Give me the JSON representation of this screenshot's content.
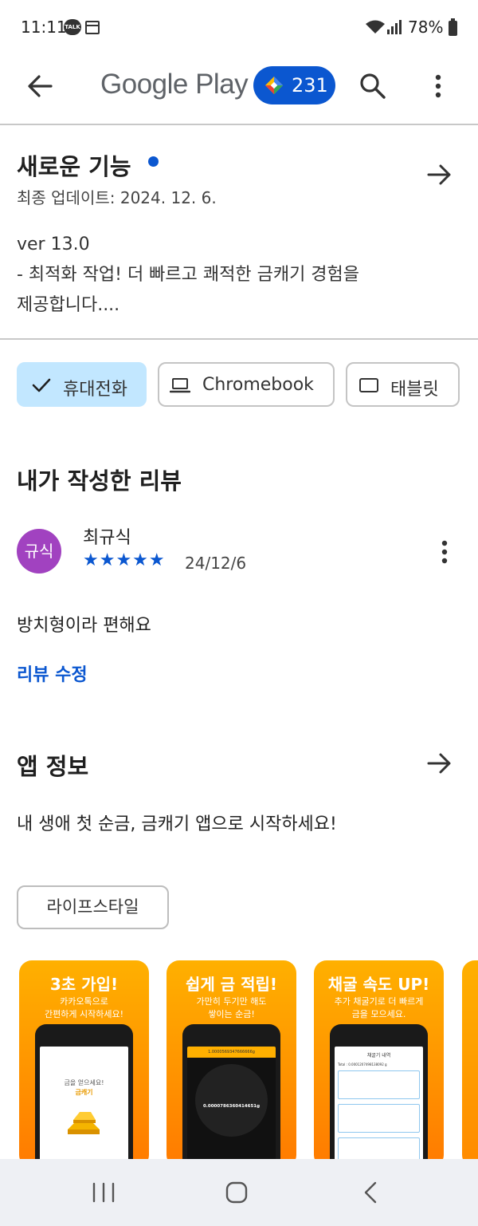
{
  "status_bar": {
    "time": "11:11",
    "talk_badge": "TALK",
    "battery": "78%"
  },
  "app_bar": {
    "brand": "Google Play",
    "points": "231"
  },
  "whats_new": {
    "title": "새로운 기능",
    "updated": "최종 업데이트: 2024. 12. 6.",
    "version": "ver 13.0",
    "body_line1": "- 최적화 작업! 더 빠르고 쾌적한 금캐기 경험을",
    "body_line2": "제공합니다...."
  },
  "devices": {
    "phone": "휴대전화",
    "chromebook": "Chromebook",
    "tablet": "태블릿"
  },
  "my_review": {
    "heading": "내가 작성한 리뷰",
    "avatar_initials": "규식",
    "author": "최규식",
    "stars": "★★★★★",
    "rating": 5,
    "date": "24/12/6",
    "text": "방치형이라 편해요",
    "edit_label": "리뷰 수정"
  },
  "app_info": {
    "heading": "앱 정보",
    "description": "내 생애 첫 순금, 금캐기 앱으로 시작하세요!",
    "category": "라이프스타일"
  },
  "screenshots": [
    {
      "title": "3초 가입!",
      "sub1": "카카오톡으로",
      "sub2": "간편하게 시작하세요!",
      "screen_l1": "금을 얻으세요!",
      "screen_l2": "금캐기"
    },
    {
      "title": "쉽게 금 적립!",
      "sub1": "가만히 두기만 해도",
      "sub2": "쌓이는 순금!",
      "screen_l1": "1.0000569347666666g",
      "screen_l2": "0.0000786360414651g"
    },
    {
      "title": "채굴 속도 UP!",
      "sub1": "추가 채굴기로 더 빠르게",
      "sub2": "금을 모으세요.",
      "screen_l1": "채굴기 내역",
      "screen_l2": "Total : 0.0001207498138092 g"
    }
  ],
  "colors": {
    "accent": "#0b57d0",
    "chip_selected": "#c2e7ff",
    "avatar": "#a142c0",
    "screenshot_orange": "#ff9300"
  }
}
